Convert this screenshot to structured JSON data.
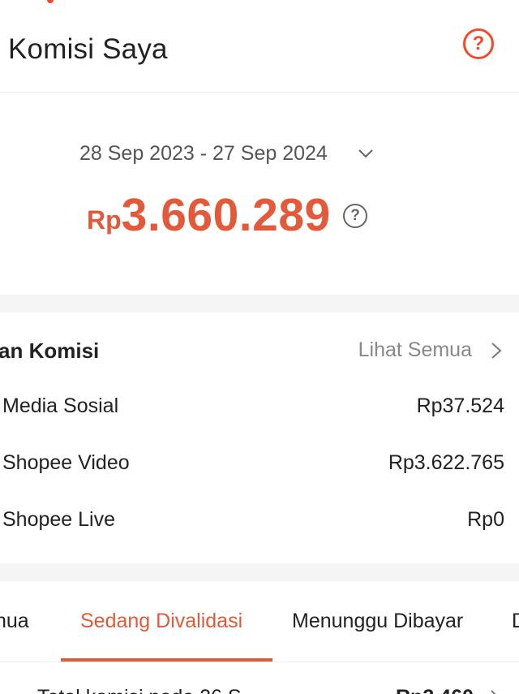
{
  "header": {
    "title": "Komisi Saya",
    "help_icon": "question-circle-icon",
    "help_glyph": "?"
  },
  "summary": {
    "date_range": "28 Sep 2023 - 27 Sep 2024",
    "currency": "Rp",
    "amount": "3.660.289",
    "info_glyph": "?"
  },
  "commission": {
    "title": "an Komisi",
    "see_all": "Lihat Semua",
    "rows": [
      {
        "label": "Media Sosial",
        "amount": "Rp37.524"
      },
      {
        "label": "Shopee Video",
        "amount": "Rp3.622.765"
      },
      {
        "label": "Shopee Live",
        "amount": "Rp0"
      }
    ]
  },
  "tabs": [
    "nua",
    "Sedang Divalidasi",
    "Menunggu Dibayar",
    "D"
  ],
  "active_tab": "Sedang Divalidasi",
  "bottom_row": {
    "label": "Total komisi pada 26 S",
    "amount": "Rp3.460"
  },
  "colors": {
    "accent": "#ee4d2d",
    "amount": "#e25a3a",
    "divider": "#f5f5f5"
  }
}
